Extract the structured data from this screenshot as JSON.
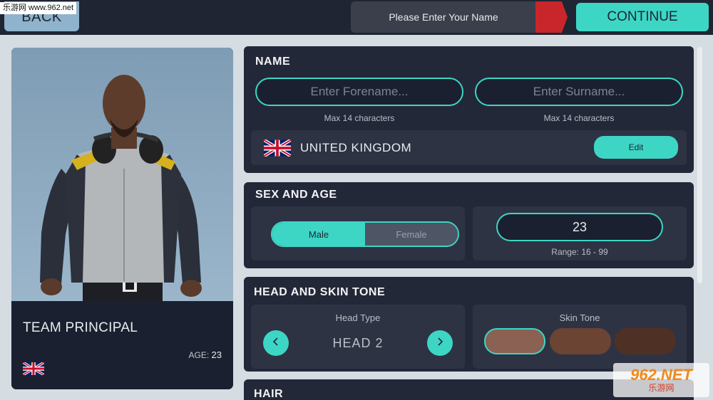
{
  "topbar": {
    "back_label": "BACK",
    "watermark": "乐游网 www.962.net",
    "name_prompt": "Please Enter Your Name",
    "continue_label": "CONTINUE"
  },
  "character": {
    "role": "TEAM PRINCIPAL",
    "age_label": "AGE:",
    "age_value": "23",
    "nationality_icon": "uk-flag-icon"
  },
  "name_section": {
    "title": "NAME",
    "forename_placeholder": "Enter Forename...",
    "surname_placeholder": "Enter Surname...",
    "forename_hint": "Max 14 characters",
    "surname_hint": "Max 14 characters",
    "country": "UNITED KINGDOM",
    "edit_label": "Edit"
  },
  "sex_age_section": {
    "title": "SEX AND AGE",
    "sex_options": [
      "Male",
      "Female"
    ],
    "selected_sex": "Male",
    "age_value": "23",
    "age_range": "Range: 16 - 99"
  },
  "head_skin_section": {
    "title": "HEAD AND SKIN TONE",
    "head_type_label": "Head Type",
    "head_value": "HEAD 2",
    "skin_tone_label": "Skin Tone",
    "skin_tones": [
      "#8a6152",
      "#6b4433",
      "#4f3025"
    ],
    "selected_skin_tone": 0
  },
  "hair_section": {
    "title": "HAIR"
  },
  "watermark_logo": {
    "line1": "962.NET",
    "line2": "乐游网"
  },
  "colors": {
    "accent": "#3dd6c5",
    "panel": "#232838",
    "flag_red": "#c9262b"
  }
}
